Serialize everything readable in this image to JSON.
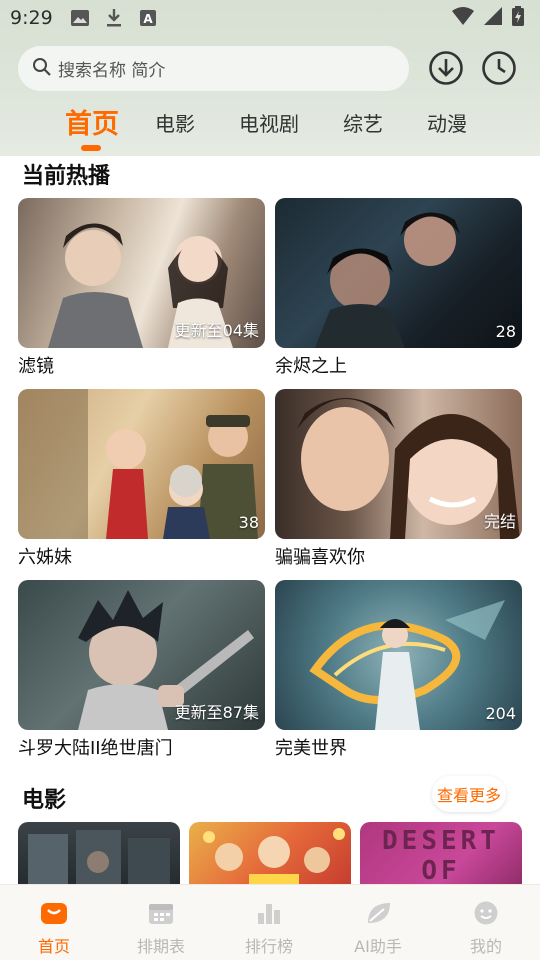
{
  "status_bar": {
    "time": "9:29",
    "left_icons": [
      "image-icon",
      "download-icon",
      "font-a-icon"
    ],
    "right_icons": [
      "wifi-icon",
      "signal-icon",
      "battery-icon"
    ]
  },
  "search": {
    "placeholder": "搜索名称 简介"
  },
  "header_buttons": [
    "download-circle-icon",
    "history-clock-icon"
  ],
  "tabs": [
    {
      "label": "首页",
      "active": true
    },
    {
      "label": "电影",
      "active": false
    },
    {
      "label": "电视剧",
      "active": false
    },
    {
      "label": "综艺",
      "active": false
    },
    {
      "label": "动漫",
      "active": false
    }
  ],
  "hot": {
    "title": "当前热播",
    "items": [
      {
        "title": "滤镜",
        "badge": "更新至04集"
      },
      {
        "title": "余烬之上",
        "badge": "28"
      },
      {
        "title": "六姊妹",
        "badge": "38"
      },
      {
        "title": "骗骗喜欢你",
        "badge": "完结"
      },
      {
        "title": "斗罗大陆II绝世唐门",
        "badge": "更新至87集"
      },
      {
        "title": "完美世界",
        "badge": "204"
      }
    ]
  },
  "movies": {
    "title": "电影",
    "more_label": "查看更多",
    "thumb_text": "DESERT OF"
  },
  "bottom_nav": [
    {
      "label": "首页",
      "icon": "home-icon",
      "active": true
    },
    {
      "label": "排期表",
      "icon": "calendar-icon",
      "active": false
    },
    {
      "label": "排行榜",
      "icon": "bar-chart-icon",
      "active": false
    },
    {
      "label": "AI助手",
      "icon": "ai-leaf-icon",
      "active": false
    },
    {
      "label": "我的",
      "icon": "smiley-icon",
      "active": false
    }
  ],
  "colors": {
    "accent": "#ff6a00",
    "inactive_nav": "#b8b8b8"
  }
}
